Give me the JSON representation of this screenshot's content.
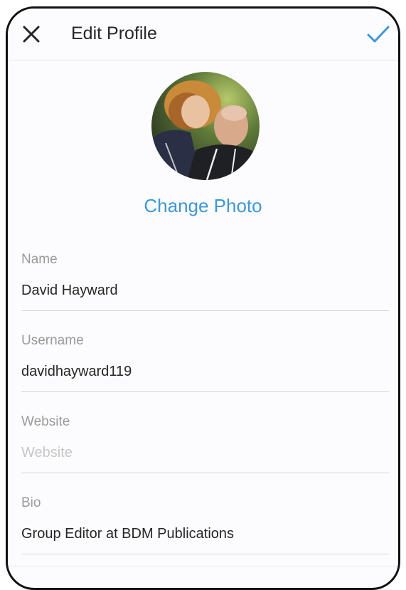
{
  "header": {
    "title": "Edit Profile",
    "close_icon": "close-icon",
    "confirm_icon": "checkmark-icon",
    "confirm_color": "#3d97d6"
  },
  "profile_photo": {
    "description_icon": "profile-photo",
    "action_label": "Change Photo",
    "accent_color": "#3d97d6"
  },
  "fields": {
    "name": {
      "label": "Name",
      "value": "David Hayward",
      "placeholder": "Name"
    },
    "username": {
      "label": "Username",
      "value": "davidhayward119",
      "placeholder": "Username"
    },
    "website": {
      "label": "Website",
      "value": "",
      "placeholder": "Website"
    },
    "bio": {
      "label": "Bio",
      "value": "Group Editor at BDM Publications",
      "placeholder": "Bio"
    }
  }
}
